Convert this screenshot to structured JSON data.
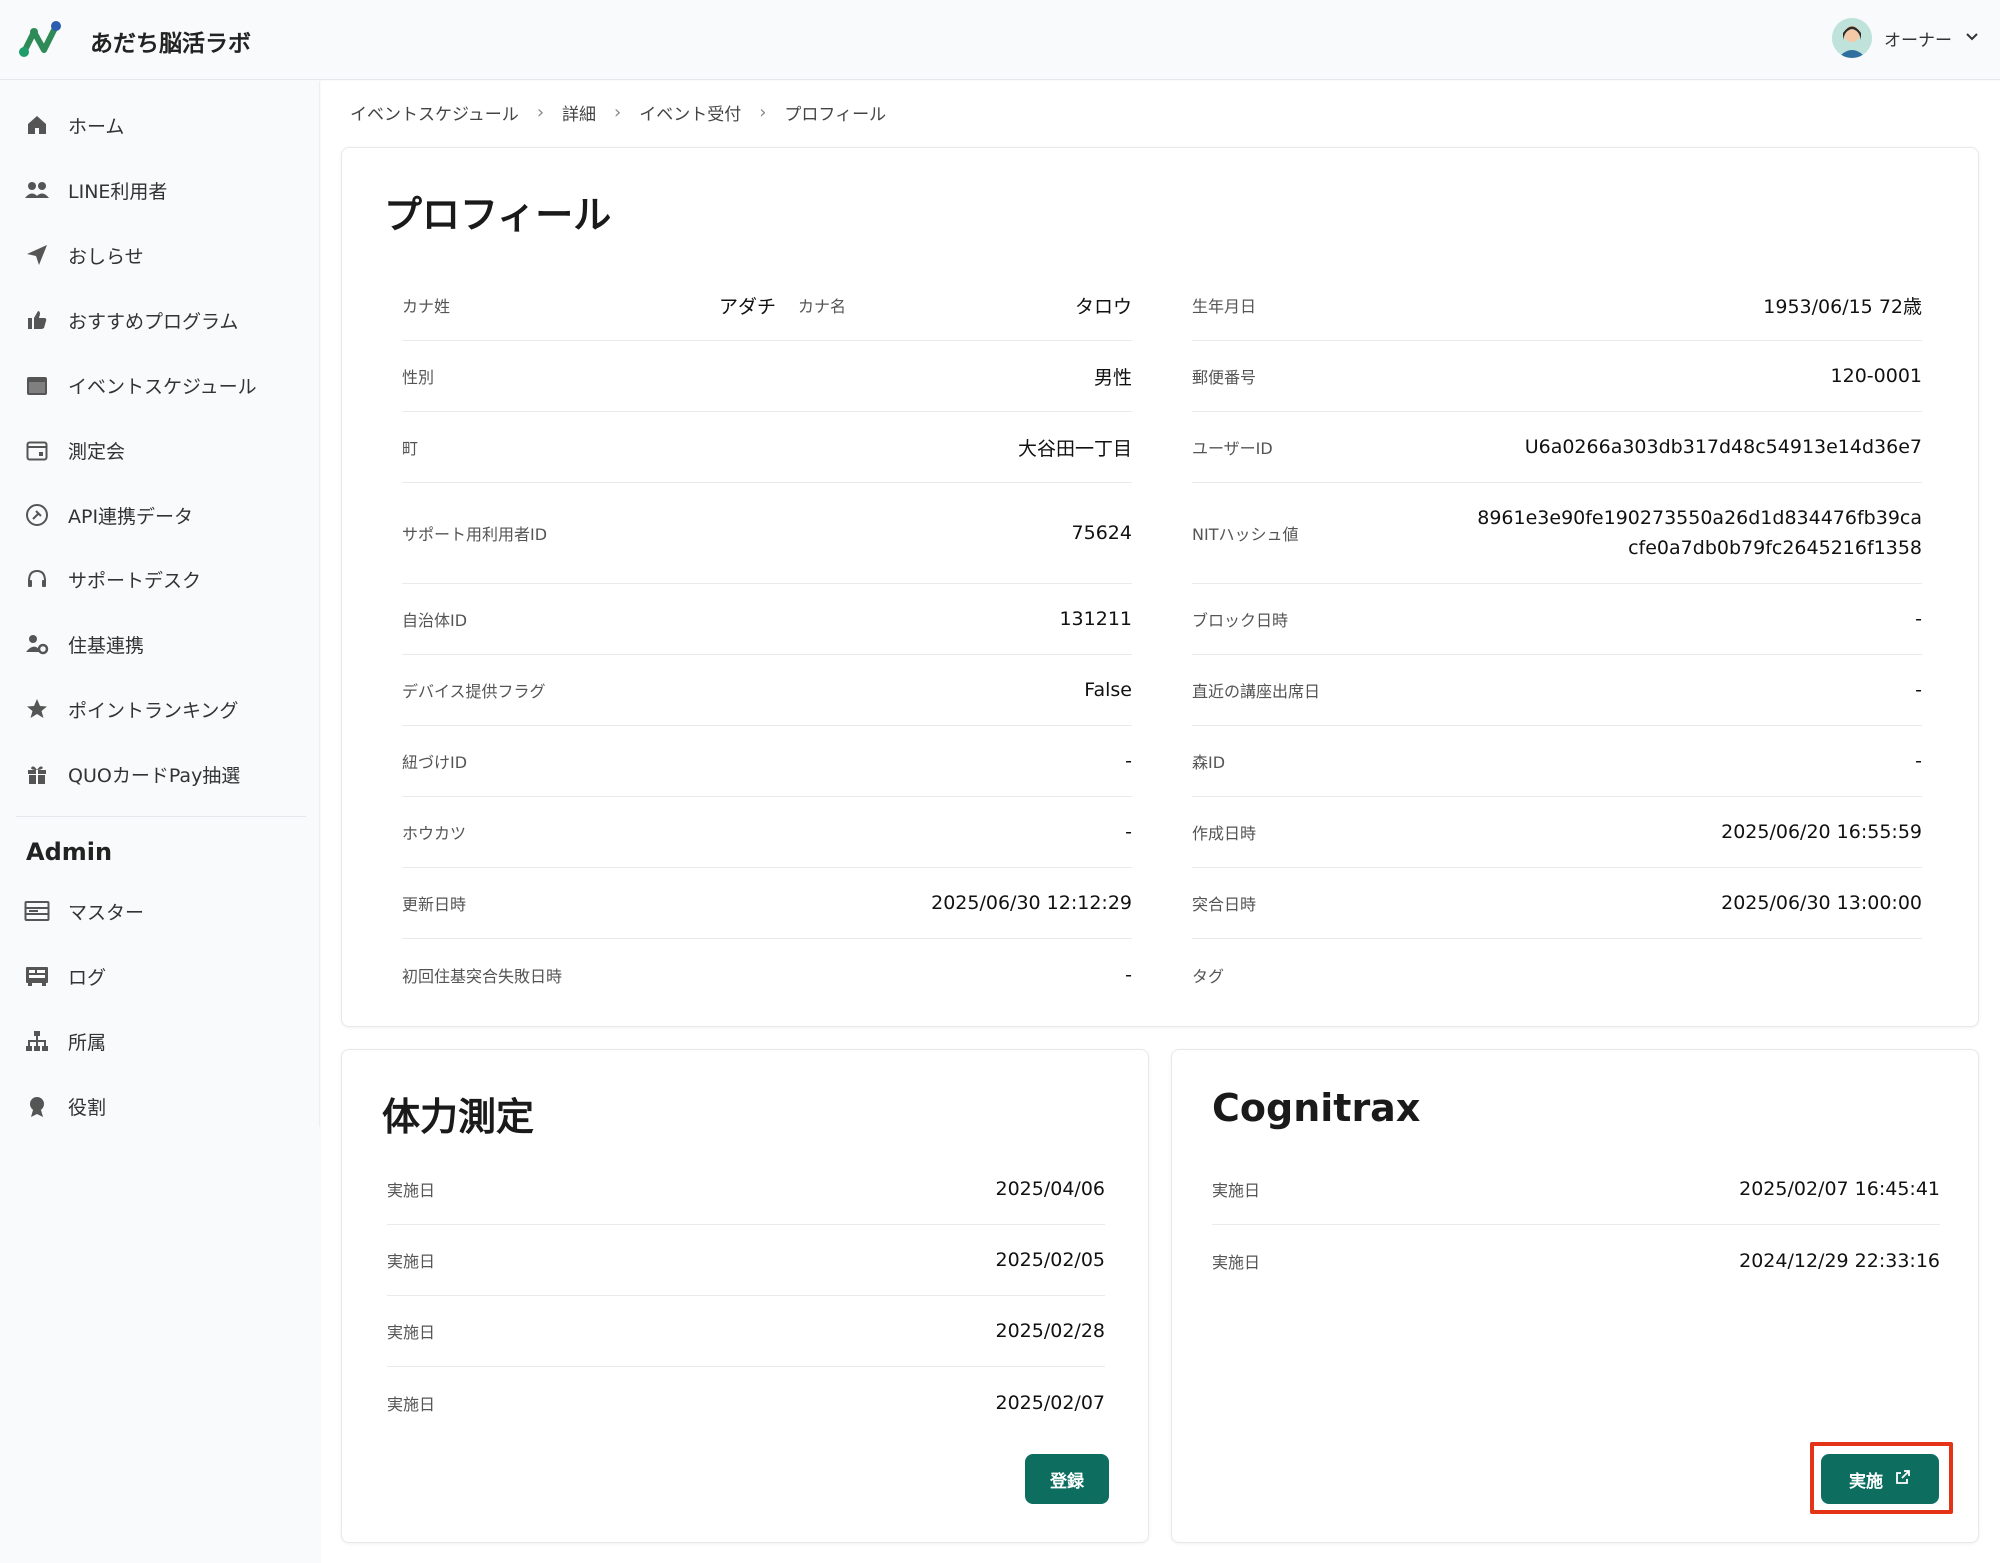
{
  "app": {
    "title": "あだち脳活ラボ"
  },
  "user": {
    "name": "オーナー"
  },
  "sidebar": {
    "items": [
      {
        "label": "ホーム"
      },
      {
        "label": "LINE利用者"
      },
      {
        "label": "おしらせ"
      },
      {
        "label": "おすすめプログラム"
      },
      {
        "label": "イベントスケジュール"
      },
      {
        "label": "測定会"
      },
      {
        "label": "API連携データ"
      },
      {
        "label": "サポートデスク"
      },
      {
        "label": "住基連携"
      },
      {
        "label": "ポイントランキング"
      },
      {
        "label": "QUOカードPay抽選"
      }
    ],
    "admin_heading": "Admin",
    "admin_items": [
      {
        "label": "マスター"
      },
      {
        "label": "ログ"
      },
      {
        "label": "所属"
      },
      {
        "label": "役割"
      }
    ]
  },
  "breadcrumb": [
    "イベントスケジュール",
    "詳細",
    "イベント受付",
    "プロフィール"
  ],
  "profile": {
    "title": "プロフィール",
    "kana_sei_label": "カナ姓",
    "kana_sei_value": "アダチ",
    "kana_mei_label": "カナ名",
    "kana_mei_value": "タロウ",
    "left": [
      {
        "label": "性別",
        "value": "男性"
      },
      {
        "label": "町",
        "value": "大谷田一丁目"
      },
      {
        "label": "サポート用利用者ID",
        "value": "75624"
      },
      {
        "label": "自治体ID",
        "value": "131211"
      },
      {
        "label": "デバイス提供フラグ",
        "value": "False"
      },
      {
        "label": "紐づけID",
        "value": "-"
      },
      {
        "label": "ホウカツ",
        "value": "-"
      },
      {
        "label": "更新日時",
        "value": "2025/06/30 12:12:29"
      },
      {
        "label": "初回住基突合失敗日時",
        "value": "-"
      }
    ],
    "right": [
      {
        "label": "生年月日",
        "value": "1953/06/15 72歳"
      },
      {
        "label": "郵便番号",
        "value": "120-0001"
      },
      {
        "label": "ユーザーID",
        "value": "U6a0266a303db317d48c54913e14d36e7"
      },
      {
        "label": "NITハッシュ値",
        "value": "8961e3e90fe190273550a26d1d834476fb39ca",
        "value2": "cfe0a7db0b79fc2645216f1358"
      },
      {
        "label": "ブロック日時",
        "value": "-"
      },
      {
        "label": "直近の講座出席日",
        "value": "-"
      },
      {
        "label": "森ID",
        "value": "-"
      },
      {
        "label": "作成日時",
        "value": "2025/06/20 16:55:59"
      },
      {
        "label": "突合日時",
        "value": "2025/06/30 13:00:00"
      },
      {
        "label": "タグ",
        "value": ""
      }
    ]
  },
  "fitness": {
    "title": "体力測定",
    "rows": [
      {
        "label": "実施日",
        "value": "2025/04/06"
      },
      {
        "label": "実施日",
        "value": "2025/02/05"
      },
      {
        "label": "実施日",
        "value": "2025/02/28"
      },
      {
        "label": "実施日",
        "value": "2025/02/07"
      }
    ],
    "button": "登録"
  },
  "cognitrax": {
    "title": "Cognitrax",
    "rows": [
      {
        "label": "実施日",
        "value": "2025/02/07 16:45:41"
      },
      {
        "label": "実施日",
        "value": "2024/12/29 22:33:16"
      }
    ],
    "button": "実施"
  },
  "colors": {
    "primary": "#0d6e60",
    "highlight": "#e53317"
  }
}
